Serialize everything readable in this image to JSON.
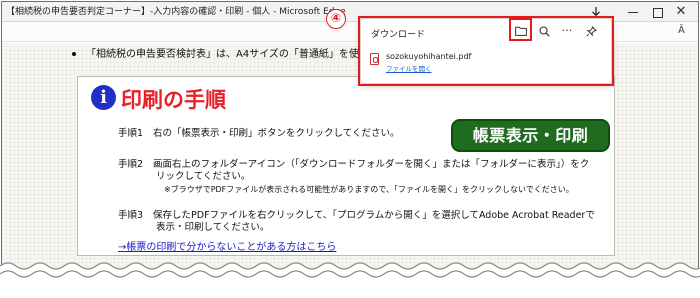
{
  "window": {
    "title": "【相続税の申告要否判定コーナー】-入力内容の確認・印刷 - 個人 - Microsoft Edge"
  },
  "icons": {
    "downloads": "download-arrow-icon",
    "folder": "folder-icon",
    "search": "search-icon",
    "more": "more-options-icon",
    "pin": "pin-icon",
    "read_aloud": "read-aloud-icon",
    "info": "info-icon",
    "pdf": "pdf-file-icon",
    "minimize": "minimize-icon",
    "maximize": "maximize-icon",
    "close": "close-icon"
  },
  "toolbar": {
    "read_aloud_label": "Â"
  },
  "page": {
    "bullet_text": "「相続税の申告要否検討表」は、A4サイズの「普通紙」を使",
    "heading": "印刷の手順",
    "print_button": "帳票表示・印刷",
    "steps": [
      {
        "label": "手順1",
        "text": "右の「帳票表示・印刷」ボタンをクリックしてください。"
      },
      {
        "label": "手順2",
        "line1": "画面右上のフォルダーアイコン（「ダウンロードフォルダーを開く」または「フォルダーに表示」）をク",
        "line2": "リックしてください。"
      },
      {
        "label": "手順3",
        "line1": "保存したPDFファイルを右クリックして、「プログラムから開く」を選択してAdobe Acrobat Readerで",
        "line2": "表示・印刷してください。"
      }
    ],
    "note": "※ブラウザでPDFファイルが表示される可能性がありますので、「ファイルを開く」をクリックしないでください。",
    "help_link": "→帳票の印刷で分からないことがある方はこちら"
  },
  "downloads_panel": {
    "title": "ダウンロード",
    "file_name": "sozokuyohihantei.pdf",
    "open_file": "ファイルを開く"
  },
  "annotation": {
    "step_marker": "④"
  },
  "colors": {
    "accent_red": "#e31b1b",
    "heading_red": "#e8202a",
    "button_green": "#1f6b1f",
    "info_blue": "#1f2fc8",
    "link_blue": "#1a1acc"
  }
}
